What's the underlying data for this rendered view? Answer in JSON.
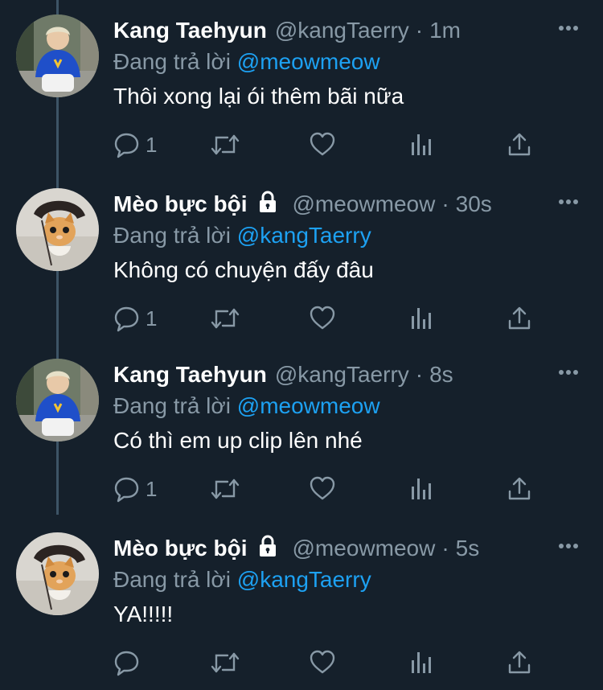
{
  "tweets": [
    {
      "author_name": "Kang Taehyun",
      "handle": "@kangTaerry",
      "time": "1m",
      "locked": false,
      "avatar": "person-in-blue-sweater-avatar",
      "reply_prefix": "Đang trả lời",
      "reply_to": "@meowmeow",
      "text": "Thôi xong lại ói thêm bãi nữa",
      "reply_count": "1"
    },
    {
      "author_name": "Mèo bực bội",
      "handle": "@meowmeow",
      "time": "30s",
      "locked": true,
      "avatar": "cat-in-hat-avatar",
      "reply_prefix": "Đang trả lời",
      "reply_to": "@kangTaerry",
      "text": "Không có chuyện đấy đâu",
      "reply_count": "1"
    },
    {
      "author_name": "Kang Taehyun",
      "handle": "@kangTaerry",
      "time": "8s",
      "locked": false,
      "avatar": "person-in-blue-sweater-avatar",
      "reply_prefix": "Đang trả lời",
      "reply_to": "@meowmeow",
      "text": "Có thì em up clip lên nhé",
      "reply_count": "1"
    },
    {
      "author_name": "Mèo bực bội",
      "handle": "@meowmeow",
      "time": "5s",
      "locked": true,
      "avatar": "cat-in-hat-avatar",
      "reply_prefix": "Đang trả lời",
      "reply_to": "@kangTaerry",
      "text": "YA!!!!!",
      "reply_count": ""
    }
  ],
  "separator": "·",
  "colors": {
    "background": "#15202b",
    "secondary_text": "#8899a6",
    "mention": "#1da1f2",
    "thread_line": "#3d5466"
  },
  "icons": [
    "reply-icon",
    "retweet-icon",
    "like-icon",
    "analytics-icon",
    "share-icon",
    "more-icon",
    "lock-icon"
  ]
}
